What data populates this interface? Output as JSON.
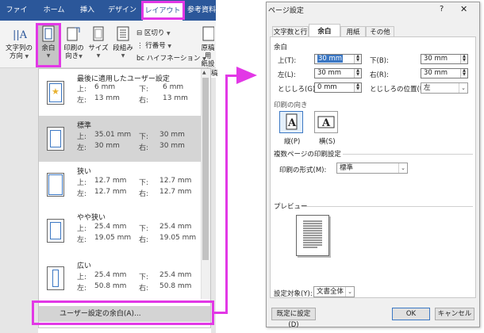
{
  "ribbon": {
    "tabs": [
      "ファイル",
      "ホーム",
      "挿入",
      "デザイン",
      "レイアウト",
      "参考資料"
    ],
    "active_tab": "レイアウト",
    "buttons": {
      "text_direction": [
        "文字列の",
        "方向"
      ],
      "margins": "余白",
      "orientation": [
        "印刷の",
        "向き"
      ],
      "size": "サイズ",
      "columns": "段組み",
      "breaks": "区切り",
      "line_numbers": "行番号",
      "hyphenation": "ハイフネーション",
      "manuscript": [
        "原稿用",
        "紙設定"
      ],
      "manuscript_short": "稿用"
    }
  },
  "margins_menu": {
    "items": [
      {
        "title": "最後に適用したユーザー設定",
        "top_label": "上:",
        "top": "6 mm",
        "bottom_label": "下:",
        "bottom": "6 mm",
        "left_label": "左:",
        "left": "13 mm",
        "right_label": "右:",
        "right": "13 mm"
      },
      {
        "title": "標準",
        "top_label": "上:",
        "top": "35.01 mm",
        "bottom_label": "下:",
        "bottom": "30 mm",
        "left_label": "左:",
        "left": "30 mm",
        "right_label": "右:",
        "right": "30 mm"
      },
      {
        "title": "狭い",
        "top_label": "上:",
        "top": "12.7 mm",
        "bottom_label": "下:",
        "bottom": "12.7 mm",
        "left_label": "左:",
        "left": "12.7 mm",
        "right_label": "右:",
        "right": "12.7 mm"
      },
      {
        "title": "やや狭い",
        "top_label": "上:",
        "top": "25.4 mm",
        "bottom_label": "下:",
        "bottom": "25.4 mm",
        "left_label": "左:",
        "left": "19.05 mm",
        "right_label": "右:",
        "right": "19.05 mm"
      },
      {
        "title": "広い",
        "top_label": "上:",
        "top": "25.4 mm",
        "bottom_label": "下:",
        "bottom": "25.4 mm",
        "left_label": "左:",
        "left": "50.8 mm",
        "right_label": "右:",
        "right": "50.8 mm"
      }
    ],
    "custom_label": "ユーザー設定の余白(A)..."
  },
  "dialog": {
    "title": "ページ設定",
    "help": "?",
    "close": "✕",
    "tabs": [
      "文字数と行数",
      "余白",
      "用紙",
      "その他"
    ],
    "active_tab": "余白",
    "margins_section": "余白",
    "fields": {
      "top_label": "上(T):",
      "top_value": "30 mm",
      "bottom_label": "下(B):",
      "bottom_value": "30 mm",
      "left_label": "左(L):",
      "left_value": "30 mm",
      "right_label": "右(R):",
      "right_value": "30 mm",
      "gutter_label": "とじしろ(G):",
      "gutter_value": "0 mm",
      "gutter_pos_label": "とじしろの位置(U):",
      "gutter_pos_value": "左"
    },
    "orientation_section": "印刷の向き",
    "portrait_label": "縦(P)",
    "landscape_label": "横(S)",
    "pages_section": "複数ページの印刷設定",
    "multiple_pages_label": "印刷の形式(M):",
    "multiple_pages_value": "標準",
    "preview_section": "プレビュー",
    "apply_to_label": "設定対象(Y):",
    "apply_to_value": "文書全体",
    "default_button": "既定に設定(D)",
    "ok_button": "OK",
    "cancel_button": "キャンセル"
  },
  "colors": {
    "ribbon_blue": "#2b579a",
    "highlight_pink": "#e238e6",
    "thumb_blue": "#3c78c4"
  }
}
